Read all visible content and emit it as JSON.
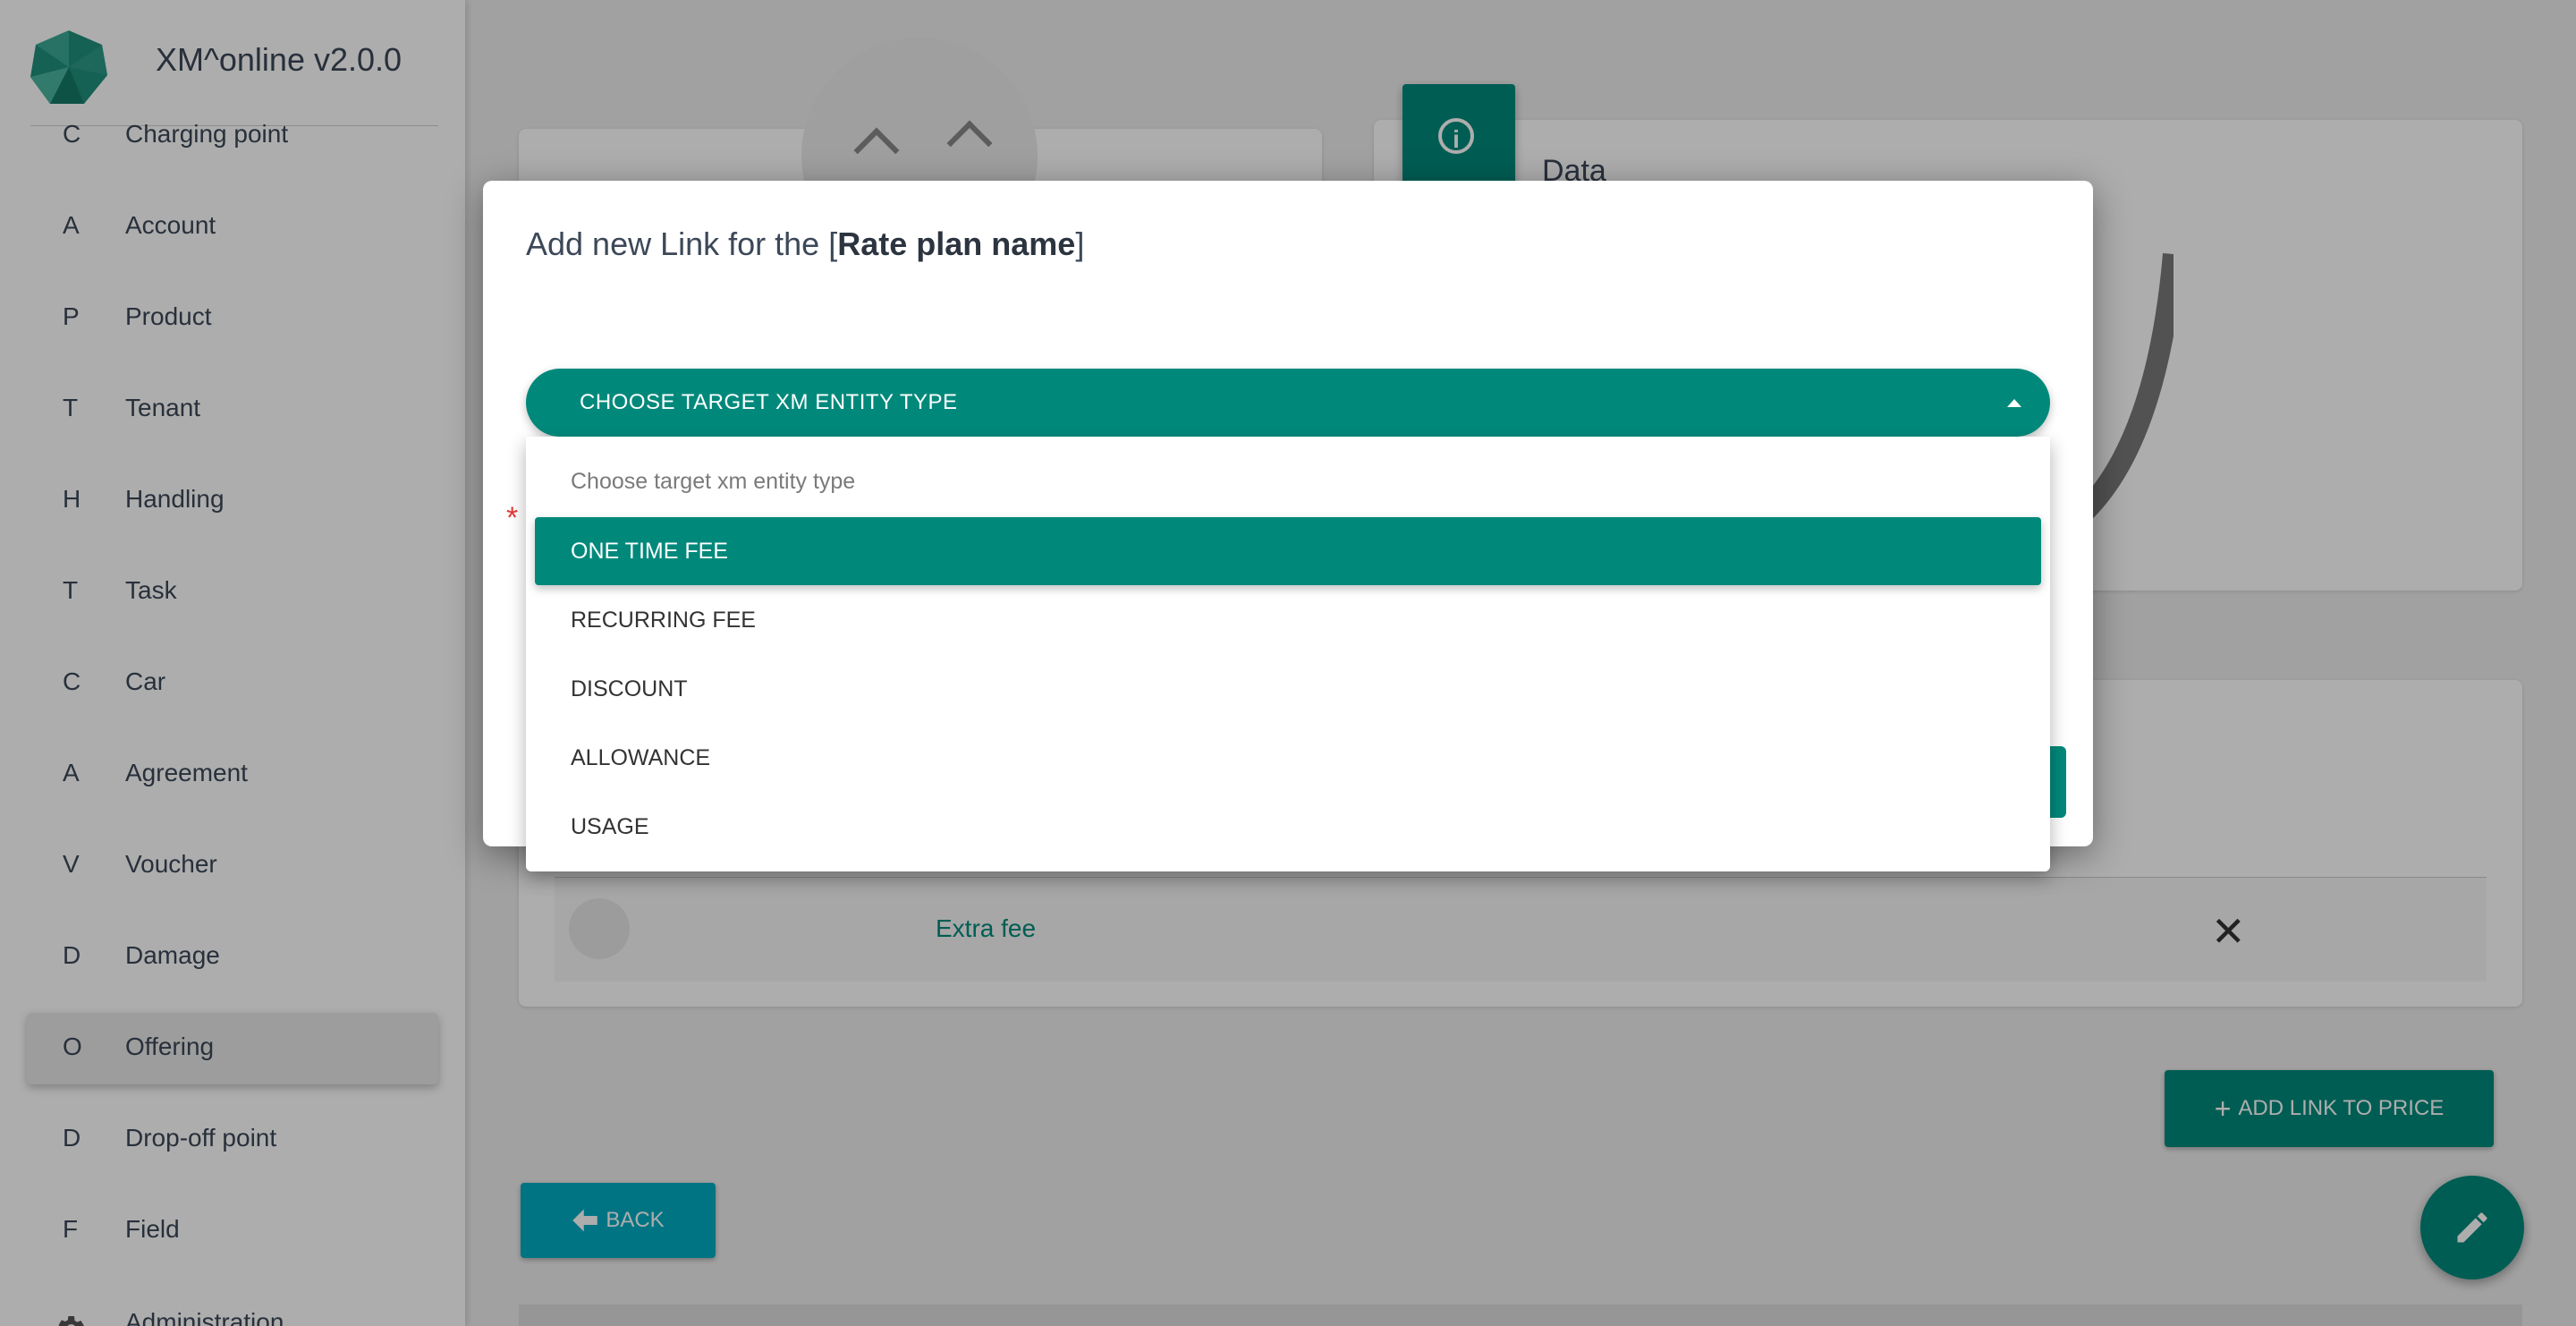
{
  "app": {
    "title": "XM^online v2.0.0"
  },
  "sidebar": {
    "items": [
      {
        "letter": "C",
        "label": "Charging point"
      },
      {
        "letter": "A",
        "label": "Account"
      },
      {
        "letter": "P",
        "label": "Product"
      },
      {
        "letter": "T",
        "label": "Tenant"
      },
      {
        "letter": "H",
        "label": "Handling"
      },
      {
        "letter": "T",
        "label": "Task"
      },
      {
        "letter": "C",
        "label": "Car"
      },
      {
        "letter": "A",
        "label": "Agreement"
      },
      {
        "letter": "V",
        "label": "Voucher"
      },
      {
        "letter": "D",
        "label": "Damage"
      },
      {
        "letter": "O",
        "label": "Offering",
        "active": true
      },
      {
        "letter": "D",
        "label": "Drop-off point"
      },
      {
        "letter": "F",
        "label": "Field"
      }
    ],
    "admin_label": "Administration"
  },
  "main": {
    "data_card_title": "Data",
    "links_row": {
      "name": "Extra fee"
    },
    "add_link_button": "ADD LINK TO PRICE",
    "back_button": "BACK"
  },
  "dialog": {
    "title_prefix": "Add new Link for the [",
    "title_entity": "Rate plan name",
    "title_suffix": "]",
    "select_label": "CHOOSE TARGET XM ENTITY TYPE",
    "dropdown": {
      "placeholder": "Choose target xm entity type",
      "options": [
        "ONE TIME FEE",
        "RECURRING FEE",
        "DISCOUNT",
        "ALLOWANCE",
        "USAGE"
      ],
      "selected": "ONE TIME FEE"
    }
  },
  "colors": {
    "primary": "#00897b",
    "back_button": "#00acc1",
    "required": "#e53935"
  }
}
